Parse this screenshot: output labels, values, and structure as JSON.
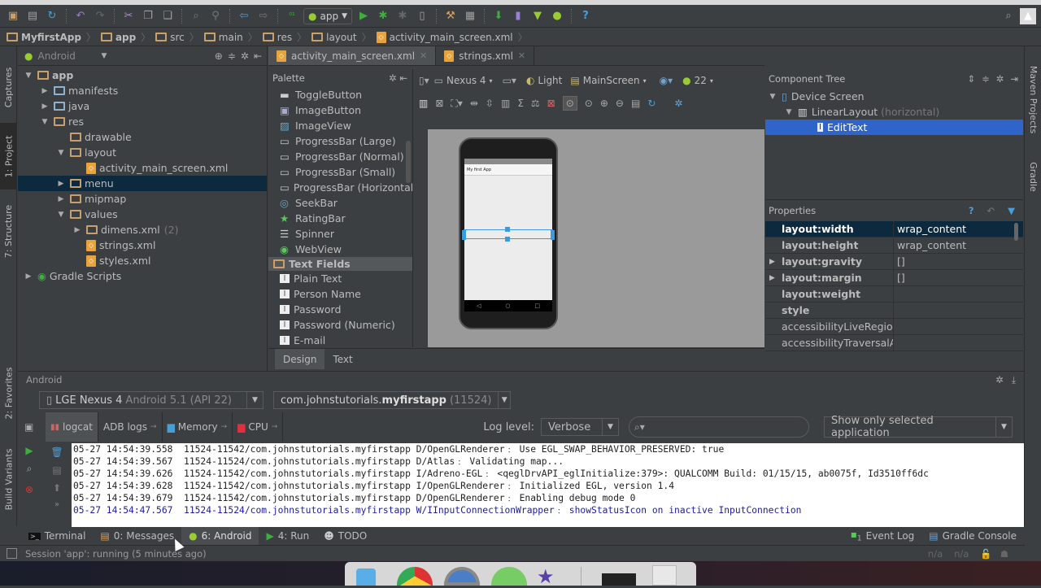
{
  "toolbar": {
    "run_config": "app",
    "icons": [
      "open-icon",
      "save-icon",
      "sync-icon",
      "undo-icon",
      "redo-icon",
      "cut-icon",
      "copy-icon",
      "paste-icon",
      "find-icon",
      "replace-icon",
      "back-icon",
      "forward-icon",
      "make-project-icon",
      "run-icon",
      "debug-icon",
      "attach-debugger-icon",
      "android-device-monitor-icon",
      "project-structure-icon",
      "sdk-manager-icon",
      "avd-manager-icon",
      "android-sync-icon",
      "help-icon"
    ]
  },
  "breadcrumb": [
    "MyfirstApp",
    "app",
    "src",
    "main",
    "res",
    "layout",
    "activity_main_screen.xml"
  ],
  "left_strip": {
    "tabs": [
      "Captures",
      "1: Project",
      "7: Structure",
      "2: Favorites",
      "Build Variants"
    ]
  },
  "right_strip": {
    "tabs": [
      "Maven Projects",
      "Gradle"
    ]
  },
  "project": {
    "view_selector": "Android",
    "tree": [
      {
        "label": "app",
        "level": 0,
        "expanded": true,
        "bold": true,
        "icon": "module"
      },
      {
        "label": "manifests",
        "level": 1,
        "expanded": false,
        "icon": "folder"
      },
      {
        "label": "java",
        "level": 1,
        "expanded": false,
        "icon": "folder"
      },
      {
        "label": "res",
        "level": 1,
        "expanded": true,
        "icon": "res-folder"
      },
      {
        "label": "drawable",
        "level": 2,
        "icon": "folder"
      },
      {
        "label": "layout",
        "level": 2,
        "expanded": true,
        "icon": "folder"
      },
      {
        "label": "activity_main_screen.xml",
        "level": 3,
        "icon": "xml"
      },
      {
        "label": "menu",
        "level": 2,
        "expanded": false,
        "selected": true,
        "icon": "folder"
      },
      {
        "label": "mipmap",
        "level": 2,
        "expanded": false,
        "icon": "folder"
      },
      {
        "label": "values",
        "level": 2,
        "expanded": true,
        "icon": "folder"
      },
      {
        "label": "dimens.xml",
        "count": "(2)",
        "level": 3,
        "expanded": false,
        "icon": "folder"
      },
      {
        "label": "strings.xml",
        "level": 3,
        "icon": "xml"
      },
      {
        "label": "styles.xml",
        "level": 3,
        "icon": "xml"
      },
      {
        "label": "Gradle Scripts",
        "level": 0,
        "expanded": false,
        "icon": "gradle"
      }
    ]
  },
  "editor_tabs": [
    {
      "label": "activity_main_screen.xml",
      "active": true
    },
    {
      "label": "strings.xml",
      "active": false
    }
  ],
  "palette": {
    "title": "Palette",
    "items": [
      {
        "label": "ToggleButton"
      },
      {
        "label": "ImageButton"
      },
      {
        "label": "ImageView"
      },
      {
        "label": "ProgressBar (Large)"
      },
      {
        "label": "ProgressBar (Normal)"
      },
      {
        "label": "ProgressBar (Small)"
      },
      {
        "label": "ProgressBar (Horizontal)"
      },
      {
        "label": "SeekBar"
      },
      {
        "label": "RatingBar"
      },
      {
        "label": "Spinner"
      },
      {
        "label": "WebView"
      }
    ],
    "category": "Text Fields",
    "text_fields": [
      "Plain Text",
      "Person Name",
      "Password",
      "Password (Numeric)",
      "E-mail"
    ]
  },
  "layout_toolbar": {
    "device": "Nexus 4",
    "theme": "Light",
    "activity": "MainScreen",
    "api": "22"
  },
  "preview": {
    "app_title": "My first App"
  },
  "design_tabs": [
    {
      "label": "Design",
      "active": true
    },
    {
      "label": "Text",
      "active": false
    }
  ],
  "component_tree": {
    "title": "Component Tree",
    "rows": [
      {
        "label": "Device Screen",
        "level": 0
      },
      {
        "label": "LinearLayout",
        "note": "(horizontal)",
        "level": 1
      },
      {
        "label": "EditText",
        "level": 2,
        "selected": true
      }
    ]
  },
  "properties": {
    "title": "Properties",
    "rows": [
      {
        "name": "layout:width",
        "value": "wrap_content",
        "bold": true,
        "selected": true
      },
      {
        "name": "layout:height",
        "value": "wrap_content",
        "bold": true
      },
      {
        "name": "layout:gravity",
        "value": "[]",
        "bold": true,
        "expandable": true
      },
      {
        "name": "layout:margin",
        "value": "[]",
        "bold": true,
        "expandable": true
      },
      {
        "name": "layout:weight",
        "value": "",
        "bold": true
      },
      {
        "name": "style",
        "value": "",
        "bold": true
      },
      {
        "name": "accessibilityLiveRegion",
        "value": ""
      },
      {
        "name": "accessibilityTraversalAft",
        "value": ""
      }
    ]
  },
  "android_panel": {
    "title": "Android",
    "device": "LGE Nexus 4",
    "device_detail": "Android 5.1 (API 22)",
    "process_pkg": "com.johnstutorials.",
    "process_name": "myfirstapp",
    "process_pid": "(11524)",
    "tabs": [
      {
        "label": "logcat",
        "active": true
      },
      {
        "label": "ADB logs"
      },
      {
        "label": "Memory"
      },
      {
        "label": "CPU"
      }
    ],
    "log_level_label": "Log level:",
    "log_level": "Verbose",
    "search_placeholder": "",
    "filter": "Show only selected application",
    "log_lines": [
      {
        "text": "05-27 14:54:39.558  11524-11542/com.johnstutorials.myfirstapp D/OpenGLRenderer﹕ Use EGL_SWAP_BEHAVIOR_PRESERVED: true",
        "level": "D"
      },
      {
        "text": "05-27 14:54:39.567  11524-11524/com.johnstutorials.myfirstapp D/Atlas﹕ Validating map...",
        "level": "D"
      },
      {
        "text": "05-27 14:54:39.626  11524-11542/com.johnstutorials.myfirstapp I/Adreno-EGL﹕ <qeglDrvAPI_eglInitialize:379>: QUALCOMM Build: 01/15/15, ab0075f, Id3510ff6dc",
        "level": "I"
      },
      {
        "text": "05-27 14:54:39.628  11524-11542/com.johnstutorials.myfirstapp I/OpenGLRenderer﹕ Initialized EGL, version 1.4",
        "level": "I"
      },
      {
        "text": "05-27 14:54:39.679  11524-11542/com.johnstutorials.myfirstapp D/OpenGLRenderer﹕ Enabling debug mode 0",
        "level": "D"
      },
      {
        "text": "05-27 14:54:47.567  11524-11524/com.johnstutorials.myfirstapp W/IInputConnectionWrapper﹕ showStatusIcon on inactive InputConnection",
        "level": "W"
      }
    ]
  },
  "bottom_tabs": {
    "left": [
      {
        "label": "Terminal",
        "icon": "terminal-icon"
      },
      {
        "label": "0: Messages",
        "icon": "messages-icon"
      },
      {
        "label": "6: Android",
        "icon": "android-icon",
        "active": true
      },
      {
        "label": "4: Run",
        "icon": "run-icon"
      },
      {
        "label": "TODO",
        "icon": "todo-icon"
      }
    ],
    "right": [
      {
        "label": "Event Log",
        "badge": "1",
        "icon": "event-log-icon"
      },
      {
        "label": "Gradle Console",
        "icon": "gradle-console-icon"
      }
    ]
  },
  "status_bar": {
    "message": "Session 'app': running (5 minutes ago)",
    "pos1": "n/a",
    "pos2": "n/a"
  },
  "colors": {
    "selection": "#2f65ca",
    "tree_selection": "#0d293e",
    "warn_log": "#1c1c9c",
    "accent_green": "#3fae3f"
  }
}
